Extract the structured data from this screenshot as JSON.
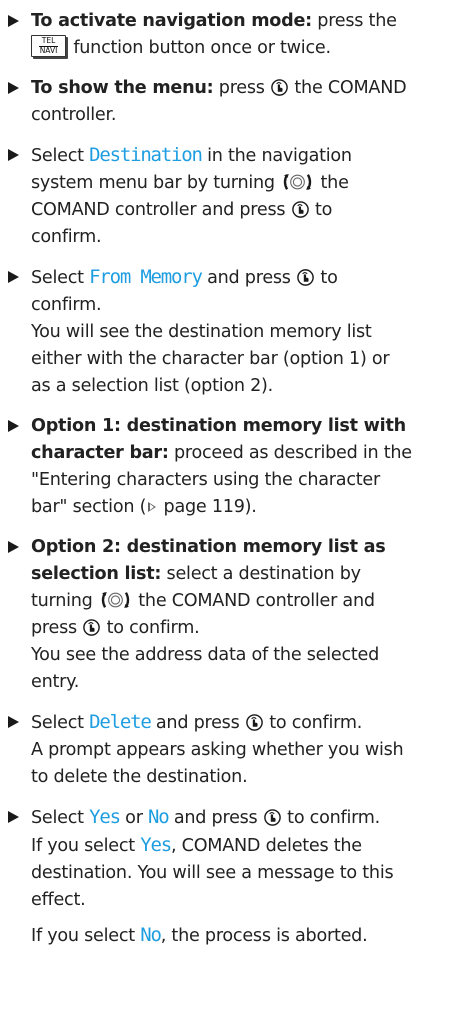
{
  "steps": [
    {
      "lead": "To activate navigation mode:",
      "t1": " press the",
      "key_top": "TEL",
      "key_bottom": "NAVI",
      "t2": " function button once or twice."
    },
    {
      "lead": "To show the menu:",
      "t1": " press ",
      "t2": " the COMAND",
      "t3": "controller."
    },
    {
      "t1": "Select ",
      "m1": "Destination",
      "t2": " in the navigation",
      "t3": "system menu bar by turning ",
      "t4": " the",
      "t5": "COMAND controller and press ",
      "t6": " to",
      "t7": "confirm."
    },
    {
      "t1": "Select ",
      "m1": "From Memory",
      "t2": " and press ",
      "t3": " to",
      "t4": "confirm.",
      "p1": "You will see the destination memory list",
      "p2": "either with the character bar (option 1) or",
      "p3": "as a selection list (option 2)."
    },
    {
      "lead1": "Option 1: destination memory list with",
      "lead2": "character bar:",
      "t1": " proceed as described in the",
      "t2": "\"Entering characters using the character",
      "t3": "bar\" section (",
      "t4": " page 119)."
    },
    {
      "lead1": "Option 2: destination memory list as",
      "lead2": "selection list:",
      "t1": " select a destination by",
      "t2": "turning ",
      "t3": " the COMAND controller and",
      "t4": "press ",
      "t5": " to confirm.",
      "p1": "You see the address data of the selected",
      "p2": "entry."
    },
    {
      "t1": "Select ",
      "m1": "Delete",
      "t2": " and press ",
      "t3": " to confirm.",
      "p1": "A prompt appears asking whether you wish",
      "p2": "to delete the destination."
    },
    {
      "t1": "Select ",
      "m1": "Yes",
      "t2": " or ",
      "m2": "No",
      "t3": " and press ",
      "t4": " to confirm.",
      "p1a": "If you select ",
      "p1m": "Yes",
      "p1b": ", COMAND deletes the",
      "p2": "destination. You will see a message to this",
      "p3": "effect.",
      "p4a": "If you select ",
      "p4m": "No",
      "p4b": ", the process is aborted."
    }
  ],
  "colors": {
    "menu_item": "#1e9ee0",
    "text": "#222222"
  },
  "icons": {
    "bullet": "triangle-bullet-icon",
    "press": "press-controller-icon",
    "turn": "turn-controller-icon",
    "page_ref": "page-reference-arrow-icon",
    "key": "tel-navi-function-key-icon"
  }
}
